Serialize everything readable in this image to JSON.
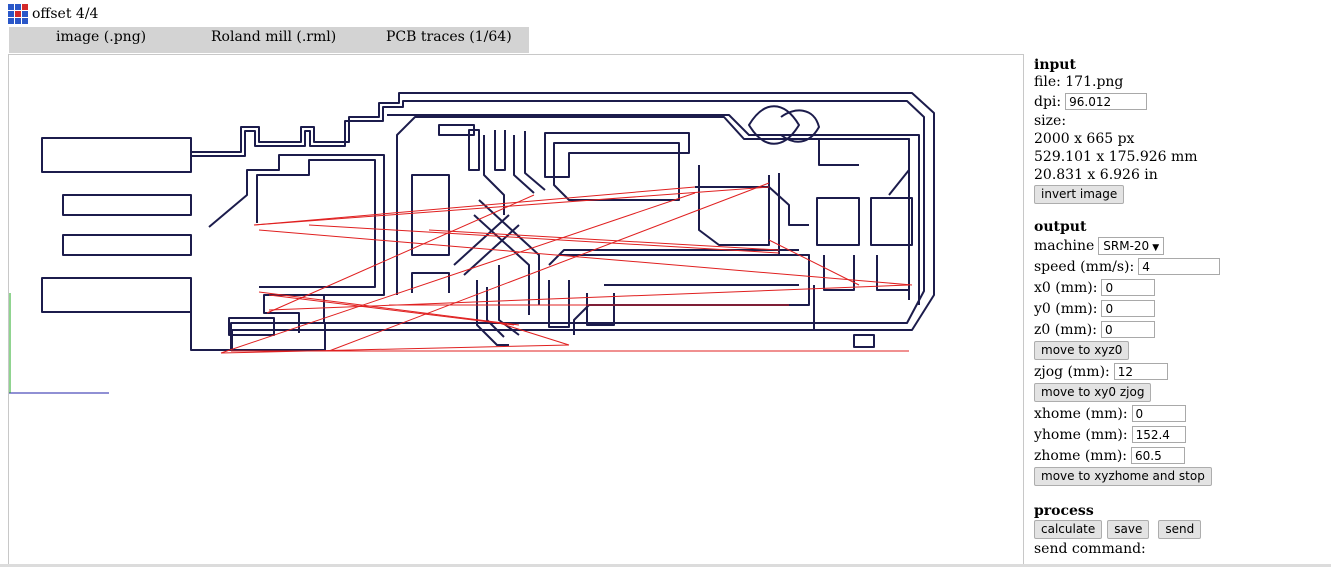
{
  "app": {
    "title": "offset 4/4",
    "logo_colors": [
      "#2a57c8",
      "#2a57c8",
      "#d42a2a",
      "#2a57c8",
      "#d42a2a",
      "#2a57c8",
      "#2a57c8",
      "#2a57c8",
      "#2a57c8"
    ]
  },
  "tabs": [
    "image (.png)",
    "Roland mill (.rml)",
    "PCB traces (1/64)"
  ],
  "canvas": {
    "trace_color": "#1c1c4c",
    "move_color": "#e02020",
    "axis_x_color": "#2222aa",
    "axis_y_color": "#22aa22"
  },
  "input": {
    "title": "input",
    "file": "file: 171.png",
    "dpi_label": "dpi:",
    "dpi_value": "96.012",
    "size_label": "size:",
    "size_px": "2000 x 665 px",
    "size_mm": "529.101 x 175.926 mm",
    "size_in": "20.831 x 6.926 in",
    "invert_button": "invert image"
  },
  "output": {
    "title": "output",
    "machine_label": "machine",
    "machine_value": "SRM-20",
    "speed_label": "speed (mm/s):",
    "speed_value": "4",
    "x0_label": "x0 (mm):",
    "x0_value": "0",
    "y0_label": "y0 (mm):",
    "y0_value": "0",
    "z0_label": "z0 (mm):",
    "z0_value": "0",
    "move_xyz0_button": "move to xyz0",
    "zjog_label": "zjog (mm):",
    "zjog_value": "12",
    "move_xy0_zjog_button": "move to xy0 zjog",
    "xhome_label": "xhome (mm):",
    "xhome_value": "0",
    "yhome_label": "yhome (mm):",
    "yhome_value": "152.4",
    "zhome_label": "zhome (mm):",
    "zhome_value": "60.5",
    "move_home_button": "move to xyzhome and stop"
  },
  "process": {
    "title": "process",
    "calculate_button": "calculate",
    "save_button": "save",
    "send_button": "send",
    "send_command_label": "send command:"
  }
}
